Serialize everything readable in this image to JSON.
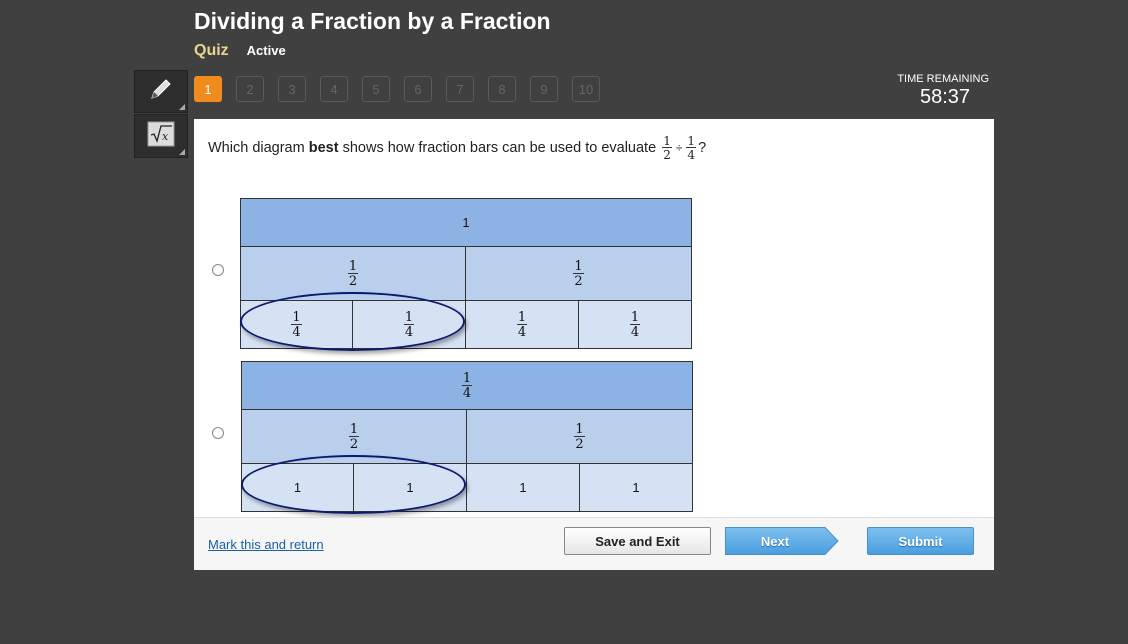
{
  "header": {
    "title": "Dividing a Fraction by a Fraction",
    "quiz_label": "Quiz",
    "status": "Active"
  },
  "tools": [
    {
      "name": "pencil-icon"
    },
    {
      "name": "sqrt-x-icon"
    }
  ],
  "question_nav": {
    "current": "1",
    "items": [
      "1",
      "2",
      "3",
      "4",
      "5",
      "6",
      "7",
      "8",
      "9",
      "10"
    ]
  },
  "timer": {
    "label": "TIME REMAINING",
    "value": "58:37"
  },
  "question": {
    "text_before": "Which diagram",
    "bold": "best",
    "text_after": "shows how fraction bars can be used to evaluate",
    "expr": {
      "a_num": "1",
      "a_den": "2",
      "op": "÷",
      "b_num": "1",
      "b_den": "4"
    },
    "end": "?"
  },
  "options": [
    {
      "top": {
        "num": "1",
        "den": ""
      },
      "middle": [
        {
          "num": "1",
          "den": "2"
        },
        {
          "num": "1",
          "den": "2"
        }
      ],
      "bottom": [
        {
          "num": "1",
          "den": "4"
        },
        {
          "num": "1",
          "den": "4"
        },
        {
          "num": "1",
          "den": "4"
        },
        {
          "num": "1",
          "den": "4"
        }
      ]
    },
    {
      "top": {
        "num": "1",
        "den": "4"
      },
      "middle": [
        {
          "num": "1",
          "den": "2"
        },
        {
          "num": "1",
          "den": "2"
        }
      ],
      "bottom": [
        {
          "num": "1",
          "den": ""
        },
        {
          "num": "1",
          "den": ""
        },
        {
          "num": "1",
          "den": ""
        },
        {
          "num": "1",
          "den": ""
        }
      ]
    }
  ],
  "footer": {
    "mark_link": "Mark this and return",
    "save_exit": "Save and Exit",
    "next": "Next",
    "submit": "Submit"
  },
  "colors": {
    "current_question": "#f08c1e",
    "bar_top": "#8db2e4",
    "bar_middle": "#b9cfec",
    "bar_bottom": "#d5e2f3",
    "circle": "#0c1a6e",
    "button_blue": "#4a9edf"
  }
}
